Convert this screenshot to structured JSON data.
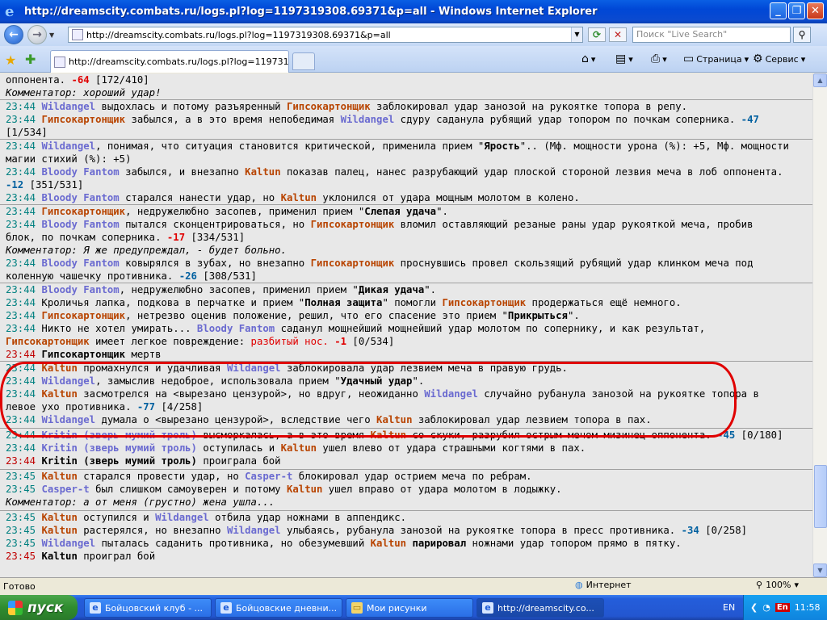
{
  "window": {
    "title": "http://dreamscity.combats.ru/logs.pl?log=1197319308.69371&p=all - Windows Internet Explorer",
    "min": "_",
    "max": "❐",
    "close": "✕"
  },
  "address": {
    "url": "http://dreamscity.combats.ru/logs.pl?log=1197319308.69371&p=all",
    "search_placeholder": "Поиск \"Live Search\""
  },
  "tabs": {
    "active_tab": "http://dreamscity.combats.ru/logs.pl?log=119731930...",
    "page_menu": "Страница",
    "service_menu": "Сервис"
  },
  "log": {
    "l01a": "оппонента. ",
    "l01b": "-64",
    "l01c": " [172/410]",
    "l02": "Комментатор: хороший удар!",
    "l03_time": "23:44",
    "l03_n1": "Wildangel",
    "l03_a": " выдохлась и потому разъяренный ",
    "l03_n2": "Гипсокартонщик",
    "l03_b": " заблокировал удар занозой на рукоятке топора в репу.",
    "l04_time": "23:44",
    "l04_n1": "Гипсокартонщик",
    "l04_a": " забылся, а в это время непобедимая ",
    "l04_n2": "Wildangel",
    "l04_b": " сдуру саданула рубящий удар топором по почкам соперника. ",
    "l04_dmg": "-47",
    "l05": "[1/534]",
    "l06_time": "23:44",
    "l06_n1": "Wildangel",
    "l06_a": ", понимая, что ситуация становится критической, применила прием \"",
    "l06_b": "Ярость",
    "l06_c": "\".. (Мф. мощности урона (%): +5, Мф. мощности",
    "l07": "магии стихий (%): +5)",
    "l08_time": "23:44",
    "l08_n1": "Bloody Fantom",
    "l08_a": " забылся, и внезапно ",
    "l08_n2": "Kaltun",
    "l08_b": " показав палец, нанес разрубающий удар плоской стороной лезвия меча в лоб оппонента.",
    "l09_dmg": "-12",
    "l09_a": " [351/531]",
    "l10_time": "23:44",
    "l10_n1": "Bloody Fantom",
    "l10_a": " старался нанести удар, но ",
    "l10_n2": "Kaltun",
    "l10_b": " уклонился от удара мощным молотом в колено.",
    "l11_time": "23:44",
    "l11_n1": "Гипсокартонщик",
    "l11_a": ", недружелюбно засопев, применил прием \"",
    "l11_b": "Слепая удача",
    "l11_c": "\".",
    "l12_time": "23:44",
    "l12_n1": "Bloody Fantom",
    "l12_a": " пытался сконцентрироваться, но ",
    "l12_n2": "Гипсокартонщик",
    "l12_b": " вломил оставляющий резаные раны удар рукояткой меча, пробив",
    "l13_a": "блок, по почкам соперника. ",
    "l13_dmg": "-17",
    "l13_b": " [334/531]",
    "l14": "Комментатор: Я же предупреждал, - будет больно.",
    "l15_time": "23:44",
    "l15_n1": "Bloody Fantom",
    "l15_a": " ковырялся в зубах, но внезапно ",
    "l15_n2": "Гипсокартонщик",
    "l15_b": " проснувшись провел скользящий рубящий удар клинком меча под",
    "l16_a": "коленную чашечку противника. ",
    "l16_dmg": "-26",
    "l16_b": " [308/531]",
    "l17_time": "23:44",
    "l17_n1": "Bloody Fantom",
    "l17_a": ", недружелюбно засопев, применил прием \"",
    "l17_b": "Дикая удача",
    "l17_c": "\".",
    "l18_time": "23:44",
    "l18_a": " Кроличья лапка, подкова в перчатке и прием \"",
    "l18_b": "Полная защита",
    "l18_c": "\" помогли ",
    "l18_n1": "Гипсокартонщик",
    "l18_d": " продержаться ещё немного.",
    "l19_time": "23:44",
    "l19_n1": "Гипсокартонщик",
    "l19_a": ", нетрезво оценив положение, решил, что его спасение это прием \"",
    "l19_b": "Прикрыться",
    "l19_c": "\".",
    "l20_time": "23:44",
    "l20_a": " Никто не хотел умирать... ",
    "l20_n1": "Bloody Fantom",
    "l20_b": " саданул мощнейший мощнейший удар молотом по сопернику, и как результат,",
    "l21_n1": "Гипсокартонщик",
    "l21_a": " имеет легкое повреждение: ",
    "l21_inj": "разбитый нос.",
    "l21_dmg": " -1",
    "l21_b": " [0/534]",
    "l22_time": "23:44",
    "l22_n1": "Гипсокартонщик",
    "l22_a": " мертв",
    "l23_time": "23:44",
    "l23_n1": "Kaltun",
    "l23_a": " промахнулся и удачливая ",
    "l23_n2": "Wildangel",
    "l23_b": " заблокировала удар лезвием меча в правую грудь.",
    "l24_time": "23:44",
    "l24_n1": "Wildangel",
    "l24_a": ", замыслив недоброе, использовала прием \"",
    "l24_b": "Удачный удар",
    "l24_c": "\".",
    "l25_time": "23:44",
    "l25_n1": "Kaltun",
    "l25_a": " засмотрелся на <вырезано цензурой>, но вдруг, неожиданно ",
    "l25_n2": "Wildangel",
    "l25_b": " случайно рубанула занозой на рукоятке топора в",
    "l26_a": "левое ухо противника. ",
    "l26_dmg": "-77",
    "l26_b": " [4/258]",
    "l27_time": "23:44",
    "l27_n1": "Wildangel",
    "l27_a": " думала о <вырезано цензурой>, вследствие чего ",
    "l27_n2": "Kaltun",
    "l27_b": " заблокировал удар лезвием топора в пах.",
    "l28_time": "23:44",
    "l28_n1": "Kritin (зверь мумий троль)",
    "l28_a": " высморкалась, а в это время ",
    "l28_n2": "Kaltun",
    "l28_b": " со скуки, разрубил острым мечом мизинец оппонента. ",
    "l28_dmg": "-45",
    "l28_c": " [0/180]",
    "l29_time": "23:44",
    "l29_n1": "Kritin (зверь мумий троль)",
    "l29_a": " оступилась и ",
    "l29_n2": "Kaltun",
    "l29_b": " ушел влево от удара страшными когтями в пах.",
    "l30_time": "23:44",
    "l30_n1": "Kritin (зверь мумий троль)",
    "l30_a": " проиграла бой",
    "l31_time": "23:45",
    "l31_n1": "Kaltun",
    "l31_a": " старался провести удар, но ",
    "l31_n2": "Casper-t",
    "l31_b": " блокировал удар острием меча по ребрам.",
    "l32_time": "23:45",
    "l32_n1": "Casper-t",
    "l32_a": " был слишком самоуверен и потому ",
    "l32_n2": "Kaltun",
    "l32_b": " ушел вправо от удара молотом в лодыжку.",
    "l33": "Комментатор: а от меня (грустно) жена ушла...",
    "l34_time": "23:45",
    "l34_n1": "Kaltun",
    "l34_a": " оступился и ",
    "l34_n2": "Wildangel",
    "l34_b": " отбила удар ножнами в аппендикс.",
    "l35_time": "23:45",
    "l35_n1": "Kaltun",
    "l35_a": " растерялся, но внезапно ",
    "l35_n2": "Wildangel",
    "l35_b": " улыбаясь, рубанула занозой на рукоятке топора в пресс противника. ",
    "l35_dmg": "-34",
    "l35_c": " [0/258]",
    "l36_time": "23:45",
    "l36_n1": "Wildangel",
    "l36_a": " пыталась саданить противника, но обезумевший ",
    "l36_n2": "Kaltun",
    "l36_b": " ",
    "l36_bold": "парировал",
    "l36_c": " ножнами удар топором прямо в пятку.",
    "l37_time": "23:45",
    "l37_n1": "Kaltun",
    "l37_a": " проиграл бой"
  },
  "status": {
    "text": "Готово",
    "zone": "Интернет",
    "zoom": "100%"
  },
  "taskbar": {
    "start": "пуск",
    "items": [
      "Бойцовский клуб - ...",
      "Бойцовские дневни...",
      "Мои рисунки",
      "http://dreamscity.co..."
    ],
    "lang": "EN",
    "lang2": "En",
    "clock": "11:58"
  }
}
